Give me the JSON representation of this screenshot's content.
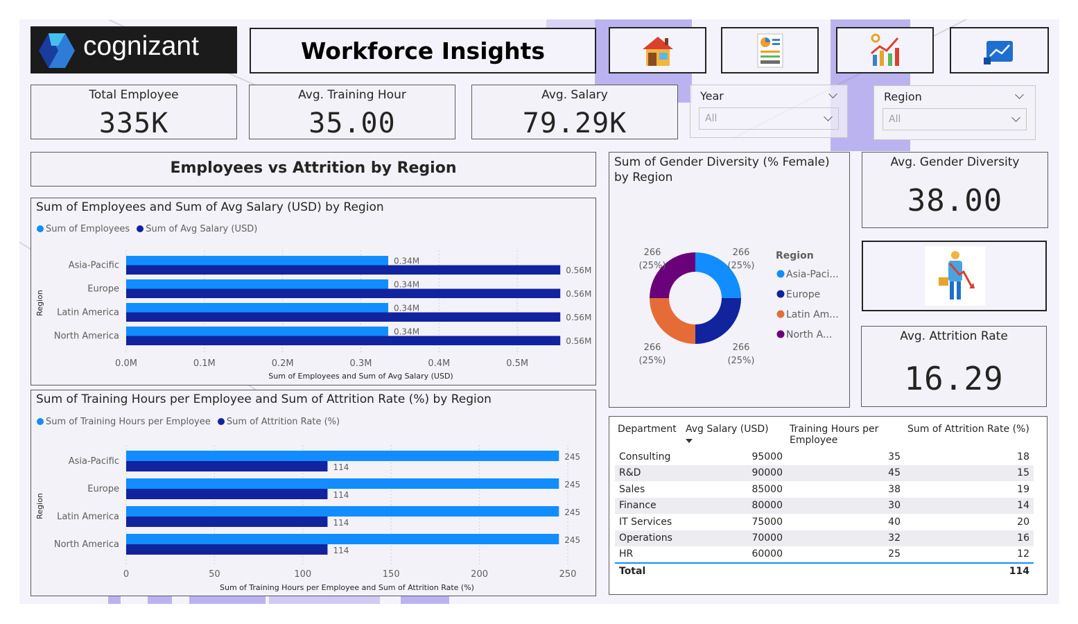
{
  "brand": {
    "name": "cognizant"
  },
  "header": {
    "title": "Workforce Insights"
  },
  "nav": [
    {
      "name": "nav-home-button",
      "icon": "house-icon"
    },
    {
      "name": "nav-report-button",
      "icon": "report-icon"
    },
    {
      "name": "nav-analytics-button",
      "icon": "analytics-icon"
    },
    {
      "name": "nav-trend-button",
      "icon": "trend-icon"
    }
  ],
  "kpis": {
    "total_employee": {
      "label": "Total Employee",
      "value": "335K"
    },
    "avg_training": {
      "label": "Avg. Training Hour",
      "value": "35.00"
    },
    "avg_salary": {
      "label": "Avg. Salary",
      "value": "79.29K"
    },
    "avg_gender": {
      "label": "Avg. Gender Diversity",
      "value": "38.00"
    },
    "avg_attrition": {
      "label": "Avg. Attrition Rate",
      "value": "16.29"
    }
  },
  "slicers": {
    "year": {
      "label": "Year",
      "value": "All"
    },
    "region": {
      "label": "Region",
      "value": "All"
    }
  },
  "section_title": "Employees vs Attrition by Region",
  "colors": {
    "light": "#118dff",
    "dark": "#12239e",
    "orange": "#e66c37",
    "purple": "#6b007b",
    "accent": "#8c7ee8"
  },
  "chart_data": [
    {
      "type": "bar",
      "title": "Sum of Employees and Sum of Avg Salary (USD) by Region",
      "xlabel": "Sum of Employees and Sum of Avg Salary (USD)",
      "ylabel": "Region",
      "categories": [
        "Asia-Pacific",
        "Europe",
        "Latin America",
        "North America"
      ],
      "series": [
        {
          "name": "Sum of Employees",
          "values": [
            0.335,
            0.335,
            0.335,
            0.335
          ],
          "labels": [
            "0.34M",
            "0.34M",
            "0.34M",
            "0.34M"
          ]
        },
        {
          "name": "Sum of Avg Salary (USD)",
          "values": [
            0.555,
            0.555,
            0.555,
            0.555
          ],
          "labels": [
            "0.56M",
            "0.56M",
            "0.56M",
            "0.56M"
          ]
        }
      ],
      "xlim": [
        0,
        0.6
      ],
      "ticks": [
        0,
        0.1,
        0.2,
        0.3,
        0.4,
        0.5
      ],
      "tick_labels": [
        "0.0M",
        "0.1M",
        "0.2M",
        "0.3M",
        "0.4M",
        "0.5M"
      ]
    },
    {
      "type": "bar",
      "title": "Sum of Training Hours per Employee and Sum of Attrition Rate (%) by Region",
      "xlabel": "Sum of Training Hours per Employee and Sum of Attrition Rate (%)",
      "ylabel": "Region",
      "categories": [
        "Asia-Pacific",
        "Europe",
        "Latin America",
        "North America"
      ],
      "series": [
        {
          "name": "Sum of Training Hours per Employee",
          "values": [
            245,
            245,
            245,
            245
          ],
          "labels": [
            "245",
            "245",
            "245",
            "245"
          ]
        },
        {
          "name": "Sum of Attrition Rate (%)",
          "values": [
            114,
            114,
            114,
            114
          ],
          "labels": [
            "114",
            "114",
            "114",
            "114"
          ]
        }
      ],
      "xlim": [
        0,
        250
      ],
      "ticks": [
        0,
        50,
        100,
        150,
        200,
        250
      ],
      "tick_labels": [
        "0",
        "50",
        "100",
        "150",
        "200",
        "250"
      ]
    },
    {
      "type": "pie",
      "title": "Sum of Gender Diversity (% Female) by Region",
      "legend_title": "Region",
      "categories": [
        "Asia-Paci...",
        "Europe",
        "Latin Am...",
        "North A..."
      ],
      "values": [
        266,
        266,
        266,
        266
      ],
      "percent_labels": [
        "(25%)",
        "(25%)",
        "(25%)",
        "(25%)"
      ]
    },
    {
      "type": "table",
      "columns": [
        "Department",
        "Avg Salary (USD)",
        "Training Hours per Employee",
        "Sum of Attrition Rate (%)"
      ],
      "rows": [
        [
          "Consulting",
          "95000",
          "35",
          "18"
        ],
        [
          "R&D",
          "90000",
          "45",
          "15"
        ],
        [
          "Sales",
          "85000",
          "38",
          "19"
        ],
        [
          "Finance",
          "80000",
          "30",
          "14"
        ],
        [
          "IT Services",
          "75000",
          "40",
          "20"
        ],
        [
          "Operations",
          "70000",
          "32",
          "16"
        ],
        [
          "HR",
          "60000",
          "25",
          "12"
        ]
      ],
      "total": [
        "Total",
        "",
        "",
        "114"
      ]
    }
  ]
}
